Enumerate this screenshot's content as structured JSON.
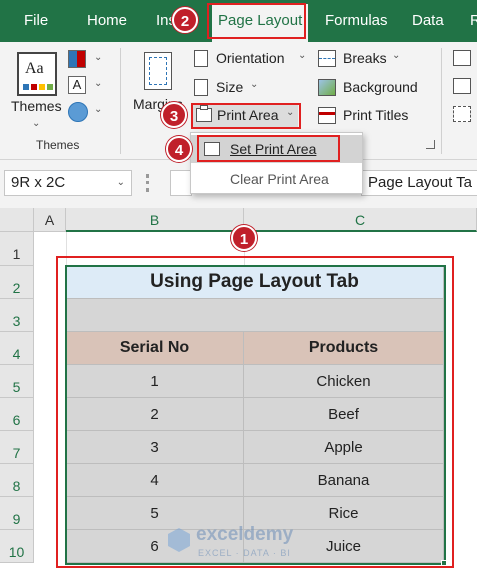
{
  "tabs": [
    {
      "label": "File"
    },
    {
      "label": "Home"
    },
    {
      "label": "Ins"
    },
    {
      "label": "Page Layout"
    },
    {
      "label": "Formulas"
    },
    {
      "label": "Data"
    },
    {
      "label": "R"
    }
  ],
  "ribbon": {
    "themes": {
      "label": "Themes",
      "group_label": "Themes"
    },
    "margins_label": "Margins",
    "orientation_label": "Orientation",
    "size_label": "Size",
    "print_area_label": "Print Area",
    "breaks_label": "Breaks",
    "background_label": "Background",
    "print_titles_label": "Print Titles"
  },
  "dropdown": {
    "items": [
      {
        "label": "Set Print Area"
      },
      {
        "label": "Clear Print Area"
      }
    ]
  },
  "formula_bar": {
    "name_box": "9R x 2C",
    "content": "Page Layout Ta"
  },
  "sheet": {
    "columns": [
      "A",
      "B",
      "C"
    ],
    "rows": [
      "1",
      "2",
      "3",
      "4",
      "5",
      "6",
      "7",
      "8",
      "9",
      "10"
    ],
    "title": "Using Page Layout Tab",
    "headers": [
      "Serial No",
      "Products"
    ],
    "data": [
      [
        "1",
        "Chicken"
      ],
      [
        "2",
        "Beef"
      ],
      [
        "3",
        "Apple"
      ],
      [
        "4",
        "Banana"
      ],
      [
        "5",
        "Rice"
      ],
      [
        "6",
        "Juice"
      ]
    ]
  },
  "watermark": {
    "name": "exceldemy",
    "tagline": "EXCEL · DATA · BI"
  },
  "badges": [
    "1",
    "2",
    "3",
    "4"
  ],
  "colors": {
    "excel_green": "#217346",
    "title_fill": "#ddebf7",
    "header_fill": "#d9c3b8",
    "data_fill": "#d6d6d6",
    "highlight_red": "#e02020"
  }
}
